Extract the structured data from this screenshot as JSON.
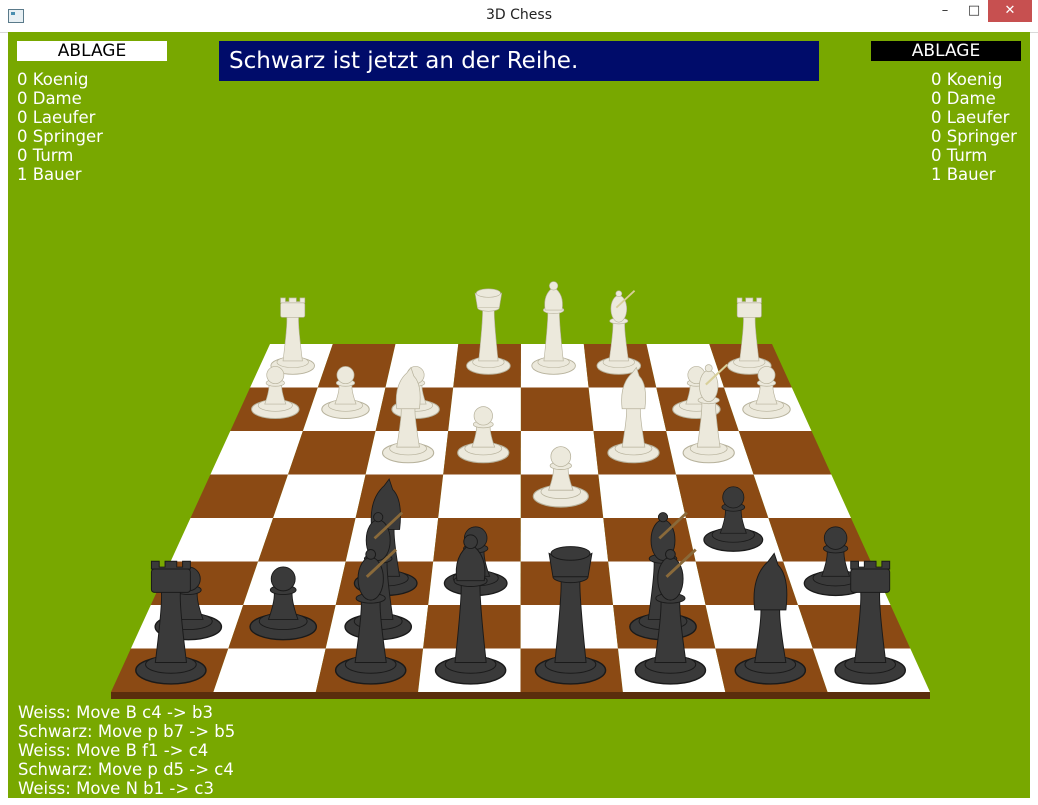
{
  "window": {
    "title": "3D Chess",
    "min_glyph": "–",
    "max_glyph": "□",
    "close_glyph": "✕"
  },
  "status": {
    "message": "Schwarz ist jetzt an der Reihe."
  },
  "ablage_left": {
    "label": "ABLAGE",
    "counts": [
      "0 Koenig",
      "0 Dame",
      "0 Laeufer",
      "0 Springer",
      "0 Turm",
      "1 Bauer"
    ]
  },
  "ablage_right": {
    "label": "ABLAGE",
    "counts": [
      "0 Koenig",
      "0 Dame",
      "0 Laeufer",
      "0 Springer",
      "0 Turm",
      "1 Bauer"
    ]
  },
  "move_log": [
    "Weiss: Move B c4 -> b3",
    "Schwarz: Move p b7 -> b5",
    "Weiss: Move B f1 -> c4",
    "Schwarz: Move p d5 -> c4",
    "Weiss: Move N b1 -> c3"
  ],
  "colors": {
    "background": "#78a800",
    "board_dark": "#8b4a14",
    "board_light": "#ffffff",
    "banner": "#000c6a",
    "white_piece": "#ece9dc",
    "black_piece": "#3a3a3a"
  },
  "pieces": [
    {
      "color": "white",
      "type": "rook",
      "file": 0,
      "rank": 7
    },
    {
      "color": "white",
      "type": "king",
      "file": 3,
      "rank": 7
    },
    {
      "color": "white",
      "type": "queen",
      "file": 4,
      "rank": 7
    },
    {
      "color": "white",
      "type": "bishop",
      "file": 5,
      "rank": 7
    },
    {
      "color": "white",
      "type": "rook",
      "file": 7,
      "rank": 7
    },
    {
      "color": "white",
      "type": "pawn",
      "file": 0,
      "rank": 6
    },
    {
      "color": "white",
      "type": "pawn",
      "file": 1,
      "rank": 6
    },
    {
      "color": "white",
      "type": "pawn",
      "file": 2,
      "rank": 6
    },
    {
      "color": "white",
      "type": "pawn",
      "file": 6,
      "rank": 6
    },
    {
      "color": "white",
      "type": "pawn",
      "file": 7,
      "rank": 6
    },
    {
      "color": "white",
      "type": "bishop",
      "file": 6,
      "rank": 5
    },
    {
      "color": "white",
      "type": "knight",
      "file": 2,
      "rank": 5
    },
    {
      "color": "white",
      "type": "pawn",
      "file": 3,
      "rank": 5
    },
    {
      "color": "white",
      "type": "knight",
      "file": 5,
      "rank": 5
    },
    {
      "color": "white",
      "type": "pawn",
      "file": 4,
      "rank": 4
    },
    {
      "color": "black",
      "type": "pawn",
      "file": 6,
      "rank": 3
    },
    {
      "color": "black",
      "type": "knight",
      "file": 2,
      "rank": 2
    },
    {
      "color": "black",
      "type": "pawn",
      "file": 3,
      "rank": 2
    },
    {
      "color": "black",
      "type": "pawn",
      "file": 7,
      "rank": 2
    },
    {
      "color": "black",
      "type": "pawn",
      "file": 0,
      "rank": 1
    },
    {
      "color": "black",
      "type": "pawn",
      "file": 1,
      "rank": 1
    },
    {
      "color": "black",
      "type": "bishop",
      "file": 2,
      "rank": 1
    },
    {
      "color": "black",
      "type": "bishop",
      "file": 5,
      "rank": 1
    },
    {
      "color": "black",
      "type": "rook",
      "file": 0,
      "rank": 0
    },
    {
      "color": "black",
      "type": "bishop",
      "file": 2,
      "rank": 0
    },
    {
      "color": "black",
      "type": "queen",
      "file": 3,
      "rank": 0
    },
    {
      "color": "black",
      "type": "king",
      "file": 4,
      "rank": 0
    },
    {
      "color": "black",
      "type": "bishop",
      "file": 5,
      "rank": 0
    },
    {
      "color": "black",
      "type": "knight",
      "file": 6,
      "rank": 0
    },
    {
      "color": "black",
      "type": "rook",
      "file": 7,
      "rank": 0
    }
  ]
}
